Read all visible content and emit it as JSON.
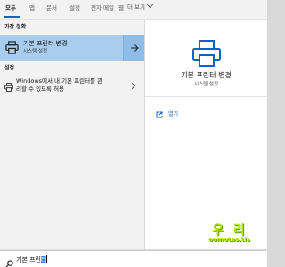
{
  "tabs": [
    {
      "label": "모두",
      "active": true
    },
    {
      "label": "앱"
    },
    {
      "label": "문서"
    },
    {
      "label": "설정"
    },
    {
      "label": "전자 메일"
    },
    {
      "label": "웹"
    }
  ],
  "more_label": "더 보기",
  "results": {
    "best_match_heading": "가장 정확",
    "best_match": {
      "title": "기본 프린터 변경",
      "subtitle": "시스템 설정",
      "icon": "printer-icon"
    },
    "settings_heading": "설정",
    "settings_item": {
      "line1": "Windows에서 내 기본 프린터를 관",
      "line2": "리할 수 있도록 허용",
      "icon": "printer-small-icon"
    }
  },
  "preview": {
    "title": "기본 프린터 변경",
    "subtitle": "시스템 설정",
    "open_label": "열기",
    "icon": "printer-large-icon"
  },
  "search": {
    "typed": "기본 프린",
    "composing": "터"
  },
  "watermark": {
    "top": "우 리",
    "bottom": "oumotas.tis"
  },
  "colors": {
    "accent": "#0a64c8",
    "selection": "#a9cdee",
    "link": "#1a5fb4",
    "watermark": "#b6e617"
  }
}
